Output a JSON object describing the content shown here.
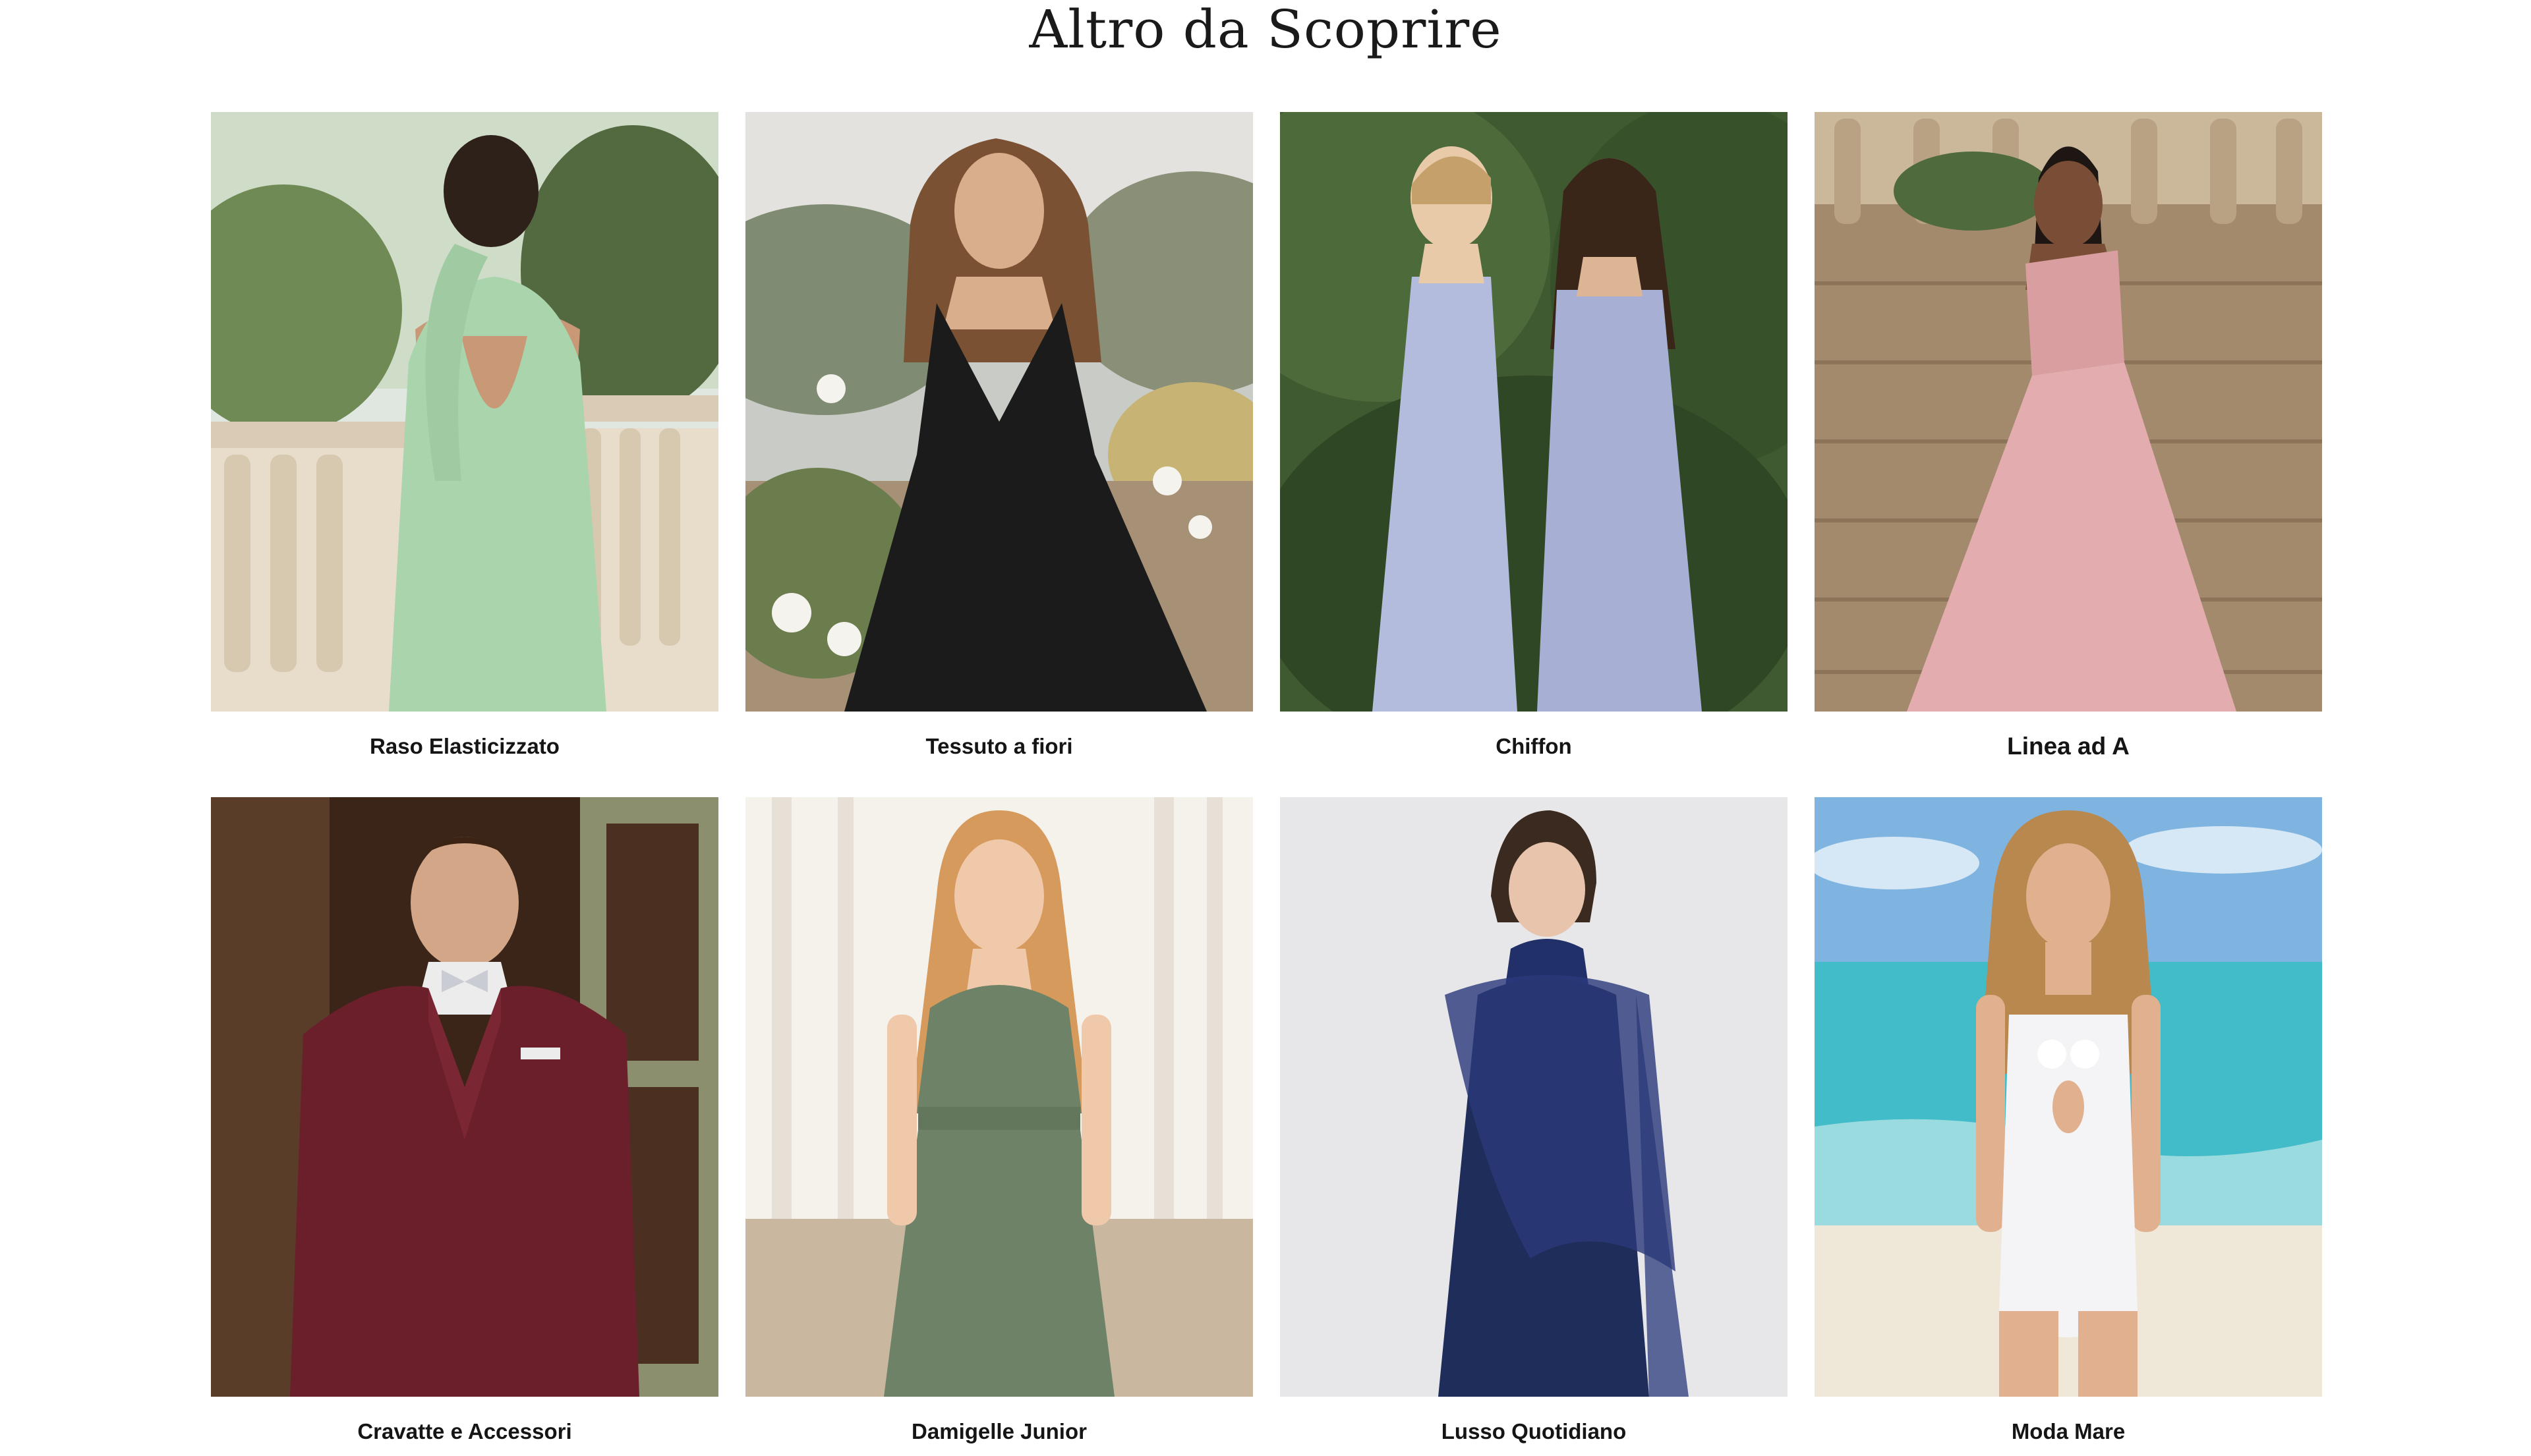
{
  "section": {
    "title": "Altro da Scoprire"
  },
  "categories": [
    {
      "label": "Raso Elasticizzato",
      "image": "model-green-satin-halter-dress",
      "dress_color": "#a9d4ac"
    },
    {
      "label": "Tessuto a fiori",
      "image": "model-black-pleated-dress",
      "dress_color": "#1b1b1b"
    },
    {
      "label": "Chiffon",
      "image": "two-models-lavender-dresses",
      "dress_color": "#b3bcdc"
    },
    {
      "label": "Linea ad A",
      "image": "model-pink-one-shoulder-gown",
      "dress_color": "#d99ea0"
    },
    {
      "label": "Cravatte e Accessori",
      "image": "model-burgundy-suit",
      "dress_color": "#6a1f2b"
    },
    {
      "label": "Damigelle Junior",
      "image": "girl-sage-green-dress",
      "dress_color": "#6d8266"
    },
    {
      "label": "Lusso Quotidiano",
      "image": "model-navy-satin-dress-with-cape",
      "dress_color": "#1f2d5a"
    },
    {
      "label": "Moda Mare",
      "image": "model-white-swimsuit-beach",
      "dress_color": "#f4f4f6"
    }
  ]
}
